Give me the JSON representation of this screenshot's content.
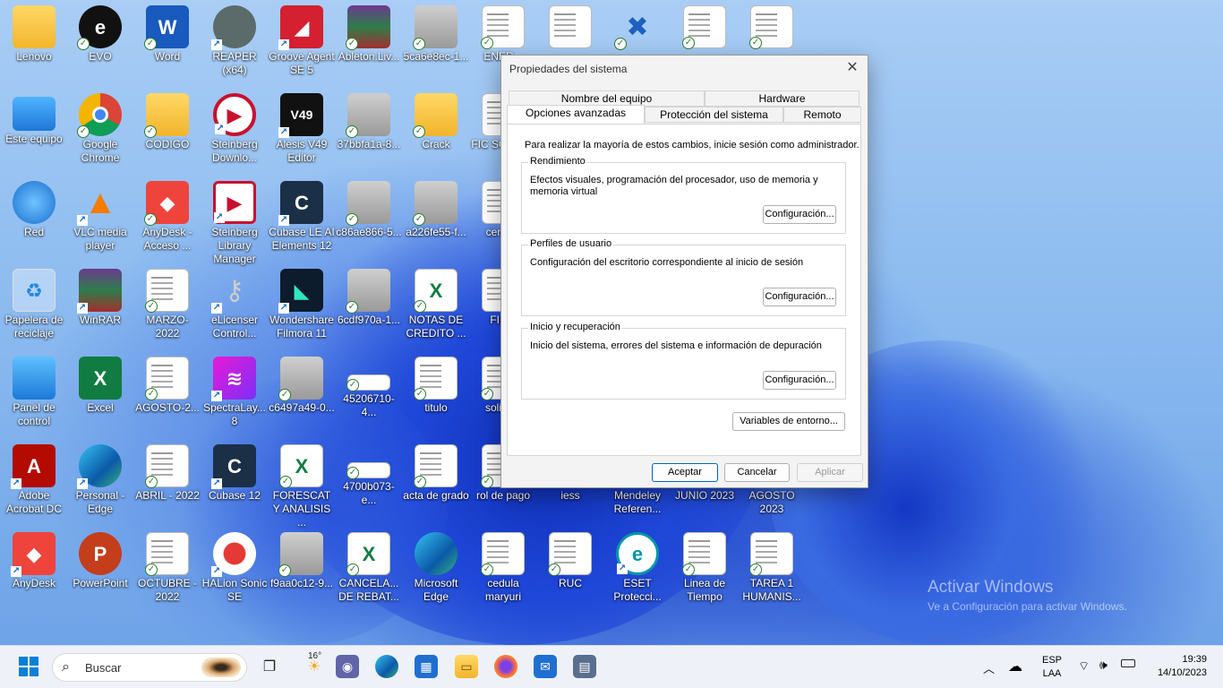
{
  "desktop_icons": [
    {
      "label": "Lenovo"
    },
    {
      "label": "EVO"
    },
    {
      "label": "Word"
    },
    {
      "label": "REAPER (x64)"
    },
    {
      "label": "Groove Agent SE 5"
    },
    {
      "label": "Ableton.Liv..."
    },
    {
      "label": "5ca6e8ec-1..."
    },
    {
      "label": "ENER..."
    },
    {
      "label": "Este equipo"
    },
    {
      "label": "Google Chrome"
    },
    {
      "label": "CODIGO"
    },
    {
      "label": "Steinberg Downlo..."
    },
    {
      "label": "Alesis V49 Editor"
    },
    {
      "label": "37bbfa1a-8..."
    },
    {
      "label": "Crack"
    },
    {
      "label": "FIC SOCIO..."
    },
    {
      "label": "Red"
    },
    {
      "label": "VLC media player"
    },
    {
      "label": "AnyDesk - Acceso ..."
    },
    {
      "label": "Steinberg Library Manager"
    },
    {
      "label": "Cubase LE AI Elements 12"
    },
    {
      "label": "c86ae866-5..."
    },
    {
      "label": "a226fe55-f..."
    },
    {
      "label": "certifi..."
    },
    {
      "label": "Papelera de reciclaje"
    },
    {
      "label": "WinRAR"
    },
    {
      "label": "MARZO-2022"
    },
    {
      "label": "eLicenser Control..."
    },
    {
      "label": "Wondershare Filmora 11"
    },
    {
      "label": "6cdf970a-1..."
    },
    {
      "label": "NOTAS DE CREDITO ..."
    },
    {
      "label": "FIR..."
    },
    {
      "label": "Panel de control"
    },
    {
      "label": "Excel"
    },
    {
      "label": "AGOSTO-2..."
    },
    {
      "label": "SpectraLay... 8"
    },
    {
      "label": "c6497a49-0..."
    },
    {
      "label": "45206710-4..."
    },
    {
      "label": "titulo"
    },
    {
      "label": "solicit..."
    },
    {
      "label": "Adobe Acrobat DC"
    },
    {
      "label": "Personal - Edge"
    },
    {
      "label": "ABRIL - 2022"
    },
    {
      "label": "Cubase 12"
    },
    {
      "label": "FORESCAT Y ANALISIS ..."
    },
    {
      "label": "4700b073-e..."
    },
    {
      "label": "acta de grado"
    },
    {
      "label": "rol de pago"
    },
    {
      "label": "iess"
    },
    {
      "label": "Mendeley Referen..."
    },
    {
      "label": "JUNIO 2023"
    },
    {
      "label": "AGOSTO 2023"
    },
    {
      "label": "AnyDesk"
    },
    {
      "label": "PowerPoint"
    },
    {
      "label": "OCTUBRE - 2022"
    },
    {
      "label": "HALion Sonic SE"
    },
    {
      "label": "f9aa0c12-9..."
    },
    {
      "label": "CANCELA... DE REBAT..."
    },
    {
      "label": "Microsoft Edge"
    },
    {
      "label": "cedula maryuri"
    },
    {
      "label": "RUC"
    },
    {
      "label": "ESET Protecci..."
    },
    {
      "label": "Linea de Tiempo"
    },
    {
      "label": "TAREA 1 HUMANIS..."
    }
  ],
  "dialog": {
    "title": "Propiedades del sistema",
    "tabs_back": [
      "Nombre del equipo",
      "Hardware"
    ],
    "tabs_front": [
      "Opciones avanzadas",
      "Protección del sistema",
      "Remoto"
    ],
    "note": "Para realizar la mayoría de estos cambios, inicie sesión como administrador.",
    "groups": [
      {
        "title": "Rendimiento",
        "text": "Efectos visuales, programación del procesador, uso de memoria y memoria virtual",
        "button": "Configuración..."
      },
      {
        "title": "Perfiles de usuario",
        "text": "Configuración del escritorio correspondiente al inicio de sesión",
        "button": "Configuración..."
      },
      {
        "title": "Inicio y recuperación",
        "text": "Inicio del sistema, errores del sistema e información de depuración",
        "button": "Configuración..."
      }
    ],
    "env_button": "Variables de entorno...",
    "ok": "Aceptar",
    "cancel": "Cancelar",
    "apply": "Aplicar"
  },
  "watermark": {
    "title": "Activar Windows",
    "subtitle": "Ve a Configuración para activar Windows."
  },
  "taskbar": {
    "search_placeholder": "Buscar",
    "weather_temp": "16°",
    "lang_top": "ESP",
    "lang_bottom": "LAA",
    "time": "19:39",
    "date": "14/10/2023"
  },
  "colors": {
    "accent": "#0067c0",
    "taskbar_bg": "#eef2f8",
    "dialog_bg": "#f3f3f3"
  }
}
